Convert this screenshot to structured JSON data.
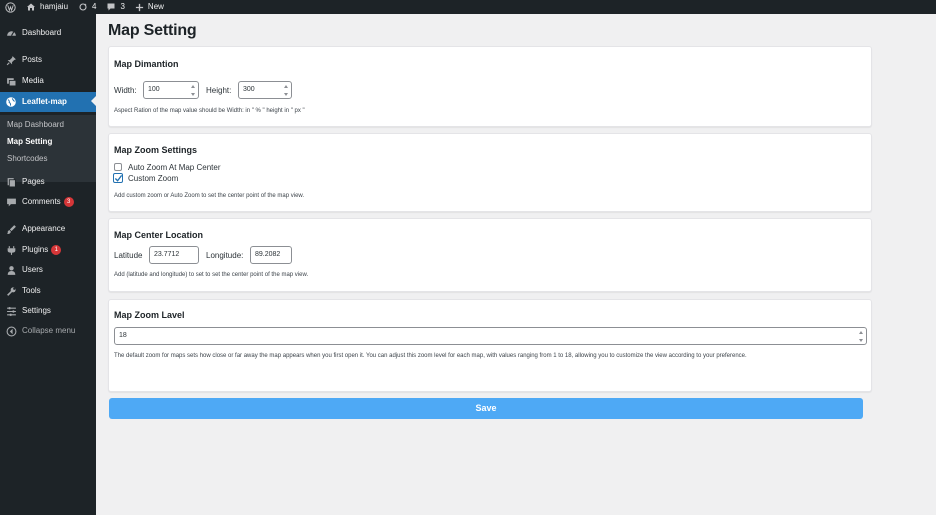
{
  "admin_bar": {
    "site_name": "hamjaiu",
    "updates_count": "4",
    "comments_count": "3",
    "new_label": "New"
  },
  "sidebar": {
    "items": [
      {
        "label": "Dashboard",
        "icon": "dashboard-icon"
      },
      {
        "label": "Posts",
        "icon": "pin-icon"
      },
      {
        "label": "Media",
        "icon": "media-icon"
      },
      {
        "label": "Leaflet-map",
        "icon": "globe-icon"
      },
      {
        "label": "Pages",
        "icon": "pages-icon"
      },
      {
        "label": "Comments",
        "icon": "comment-icon",
        "badge": "3"
      },
      {
        "label": "Appearance",
        "icon": "brush-icon"
      },
      {
        "label": "Plugins",
        "icon": "plugin-icon",
        "badge": "1"
      },
      {
        "label": "Users",
        "icon": "users-icon"
      },
      {
        "label": "Tools",
        "icon": "wrench-icon"
      },
      {
        "label": "Settings",
        "icon": "settings-icon"
      },
      {
        "label": "Collapse menu",
        "icon": "collapse-icon"
      }
    ],
    "submenu": [
      "Map Dashboard",
      "Map Setting",
      "Shortcodes"
    ]
  },
  "page_title": "Map Setting",
  "dimension": {
    "heading": "Map Dimantion",
    "width_label": "Width:",
    "width_value": "100",
    "height_label": "Height:",
    "height_value": "300",
    "help": "Aspect Ration of the map value should be Width: in \" % \" height in \" px \""
  },
  "zoom_settings": {
    "heading": "Map Zoom Settings",
    "auto_label": "Auto Zoom At Map Center",
    "auto_checked": false,
    "custom_label": "Custom Zoom",
    "custom_checked": true,
    "help": "Add custom zoom or Auto Zoom to set the center point of the map view."
  },
  "center": {
    "heading": "Map Center Location",
    "lat_label": "Latitude",
    "lat_value": "23.7712",
    "lng_label": "Longitude:",
    "lng_value": "89.2082",
    "help": "Add (latitude and longitude) to set to set the center point of the map view."
  },
  "zoom_level": {
    "heading": "Map Zoom Lavel",
    "value": "18",
    "help": "The default zoom for maps sets how close or far away the map appears when you first open it. You can adjust this zoom level for each map, with values ranging from 1 to 18, allowing you to customize the view according to your preference."
  },
  "save_label": "Save",
  "colors": {
    "sidebar_bg": "#1d2327",
    "accent": "#2271b1",
    "save_button": "#4ea9f5",
    "badge": "#d63638"
  }
}
